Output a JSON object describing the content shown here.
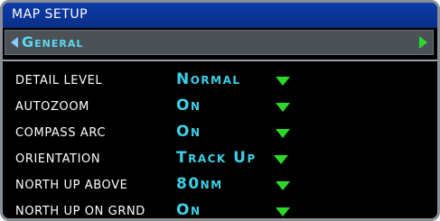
{
  "window": {
    "title": "MAP SETUP"
  },
  "category": {
    "label": "General",
    "left_arrow_icon": "left-arrow-icon",
    "right_arrow_icon": "right-arrow-icon"
  },
  "settings": [
    {
      "label": "DETAIL LEVEL",
      "value": "Normal"
    },
    {
      "label": "AUTOZOOM",
      "value": "On"
    },
    {
      "label": "COMPASS ARC",
      "value": "On"
    },
    {
      "label": "ORIENTATION",
      "value": "Track Up"
    },
    {
      "label": "NORTH UP ABOVE",
      "value": "80nm"
    },
    {
      "label": "NORTH UP ON GRND",
      "value": "On"
    }
  ],
  "colors": {
    "title_bar": "#0d3ca8",
    "category_text": "#5fd7f0",
    "value_text": "#3ecfe6",
    "dropdown_arrow": "#2bd92b",
    "background": "#000000"
  }
}
